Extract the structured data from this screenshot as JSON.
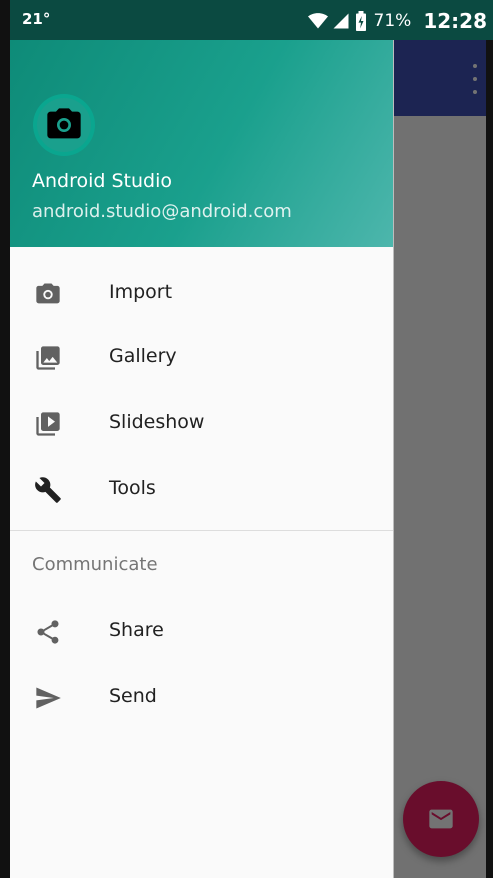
{
  "status_bar": {
    "temperature": "21°",
    "battery": "71%",
    "time": "12:28"
  },
  "drawer": {
    "header": {
      "name": "Android Studio",
      "email": "android.studio@android.com",
      "avatar_icon": "camera-icon"
    },
    "items": [
      {
        "label": "Import",
        "icon": "camera-icon"
      },
      {
        "label": "Gallery",
        "icon": "gallery-icon"
      },
      {
        "label": "Slideshow",
        "icon": "slideshow-icon"
      },
      {
        "label": "Tools",
        "icon": "wrench-icon"
      }
    ],
    "section": {
      "title": "Communicate",
      "items": [
        {
          "label": "Share",
          "icon": "share-icon"
        },
        {
          "label": "Send",
          "icon": "send-icon"
        }
      ]
    }
  },
  "colors": {
    "header_start": "#0e8b78",
    "header_end": "#4db6ac",
    "app_bar": "#3f51b5",
    "fab": "#e91e63"
  }
}
